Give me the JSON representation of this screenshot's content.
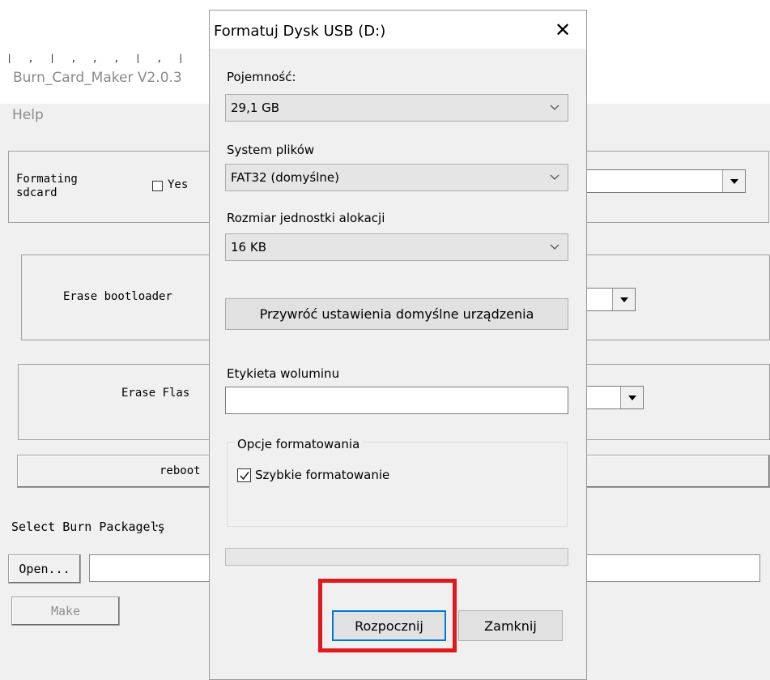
{
  "background_app": {
    "title": "Burn_Card_Maker V2.0.3",
    "menu": {
      "help_label": "Help"
    },
    "formating": {
      "label": "Formating\nsdcard",
      "checkbox_label": "Yes",
      "checked": false
    },
    "erase_bootloader_label": "Erase bootloader",
    "erase_flash_label": "Erase Flas",
    "reboot_label": "reboot",
    "select_package_label": "Select Burn Packageŀş",
    "open_button": "Open...",
    "make_button": "Make"
  },
  "dialog": {
    "title": "Formatuj Dysk USB (D:)",
    "close_glyph": "✕",
    "capacity": {
      "label": "Pojemność:",
      "value": "29,1 GB"
    },
    "filesystem": {
      "label": "System plików",
      "value": "FAT32 (domyślne)"
    },
    "allocation": {
      "label": "Rozmiar jednostki alokacji",
      "value": "16 KB"
    },
    "restore_defaults_button": "Przywróć ustawienia domyślne urządzenia",
    "volume_label": {
      "label": "Etykieta woluminu",
      "value": ""
    },
    "format_options": {
      "legend": "Opcje formatowania",
      "quick_format": {
        "label": "Szybkie formatowanie",
        "checked": true
      }
    },
    "progress": 0,
    "start_button": "Rozpocznij",
    "close_button": "Zamknij"
  },
  "colors": {
    "highlight": "#e0191f",
    "dialog_bg": "#f0f0f0",
    "accent": "#0078d7"
  }
}
